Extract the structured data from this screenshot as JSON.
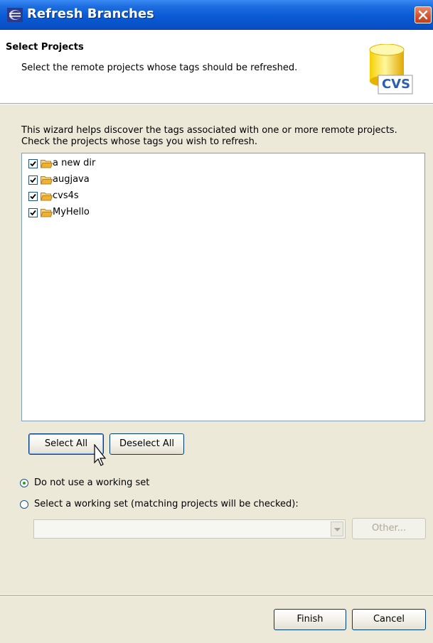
{
  "window": {
    "title": "Refresh Branches"
  },
  "header": {
    "title": "Select Projects",
    "description": "Select the remote projects whose tags should be refreshed.",
    "logo_text": "CVS"
  },
  "intro": {
    "line1": "This wizard helps discover the tags associated with one or more remote projects.",
    "line2": "Check the projects whose tags you wish to refresh."
  },
  "projects": [
    {
      "label": "a new dir",
      "checked": true
    },
    {
      "label": "augjava",
      "checked": true
    },
    {
      "label": "cvs4s",
      "checked": true
    },
    {
      "label": "MyHello",
      "checked": true
    }
  ],
  "buttons": {
    "select_all": "Select All",
    "deselect_all": "Deselect All",
    "other": "Other...",
    "finish": "Finish",
    "cancel": "Cancel"
  },
  "working_set": {
    "option_none": "Do not use a working set",
    "option_select": "Select a working set (matching projects will be checked):",
    "selected": "none",
    "combo_value": ""
  },
  "colors": {
    "titlebar": "#0a5ad6",
    "dialog_bg": "#ece9d8",
    "folder": "#f0b030"
  }
}
